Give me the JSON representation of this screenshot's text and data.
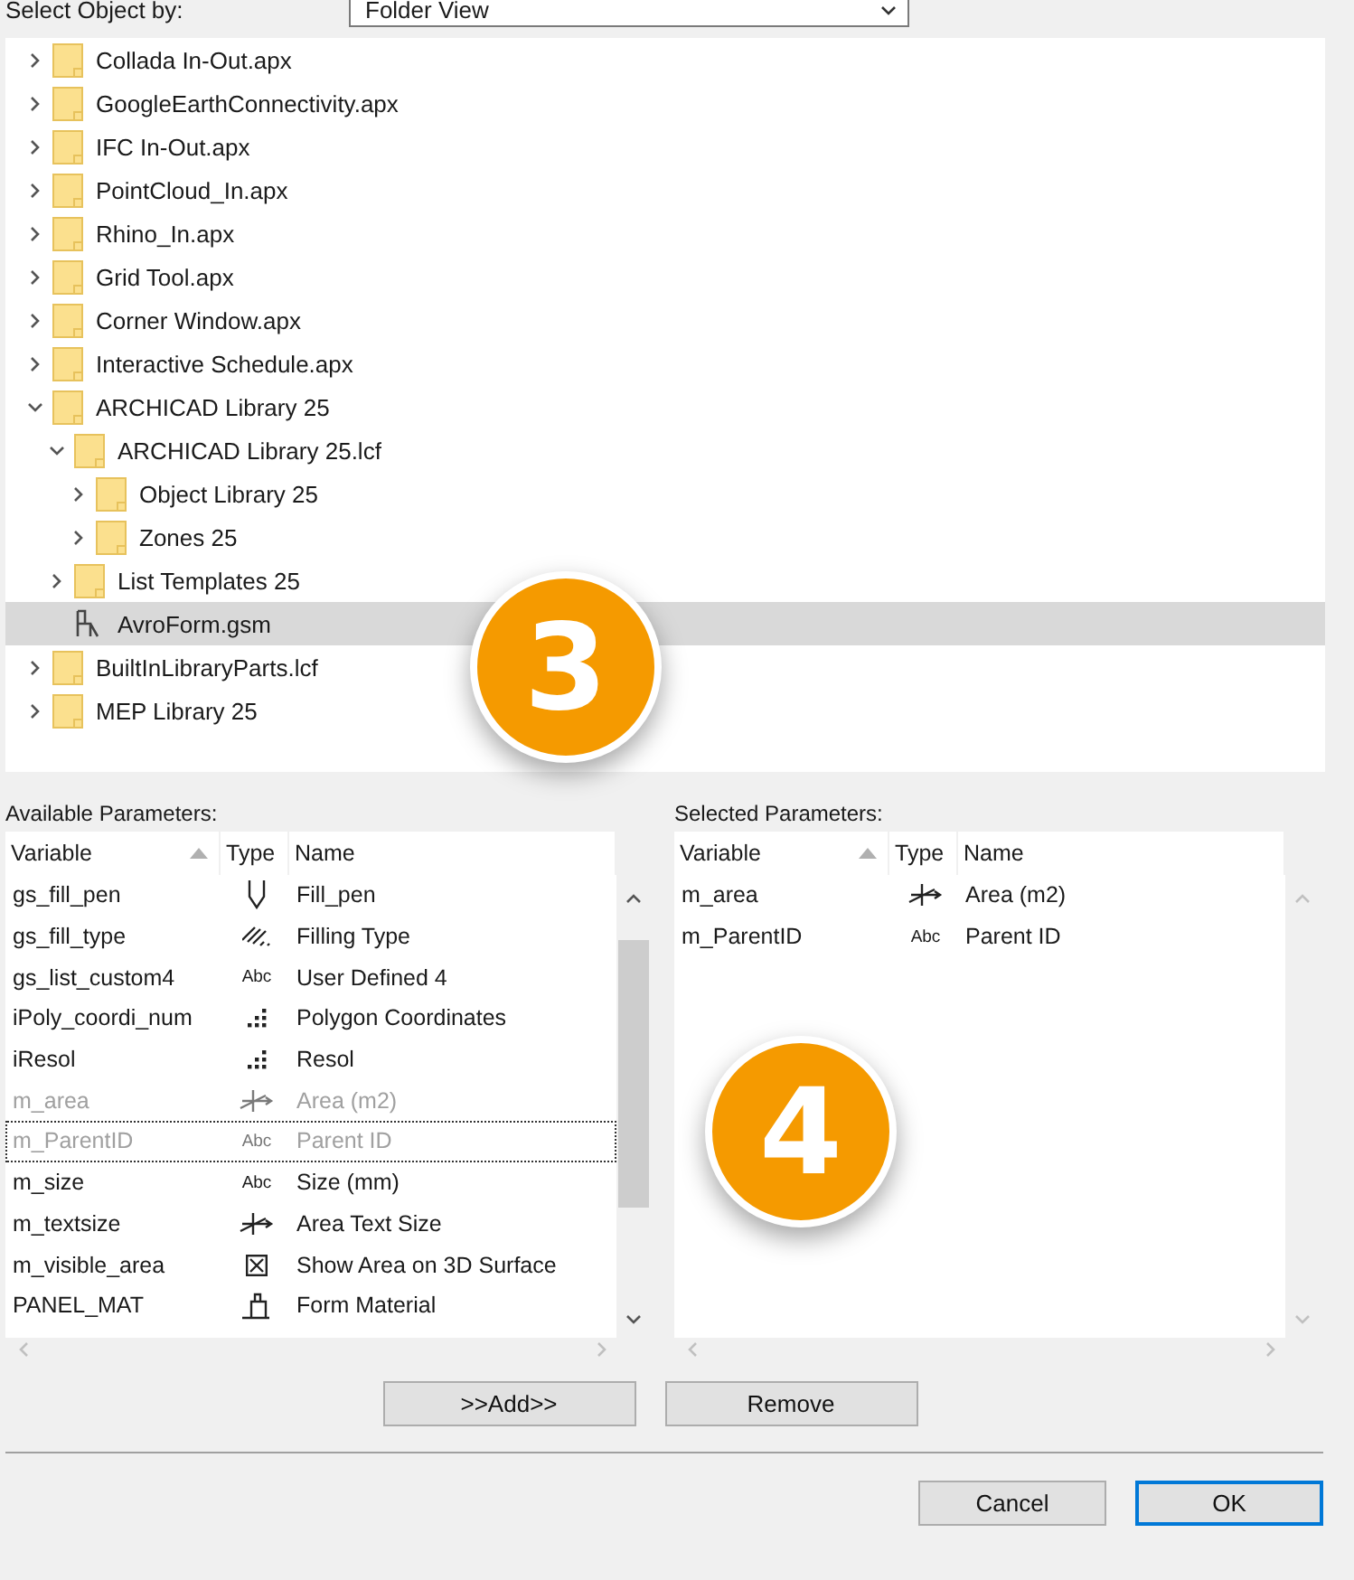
{
  "select_by": {
    "label": "Select Object by:",
    "value": "Folder View"
  },
  "tree": [
    {
      "label": "Collada In-Out.apx",
      "kind": "folder",
      "expanded": false,
      "selected": false
    },
    {
      "label": "GoogleEarthConnectivity.apx",
      "kind": "folder",
      "expanded": false,
      "selected": false
    },
    {
      "label": "IFC In-Out.apx",
      "kind": "folder",
      "expanded": false,
      "selected": false
    },
    {
      "label": "PointCloud_In.apx",
      "kind": "folder",
      "expanded": false,
      "selected": false
    },
    {
      "label": "Rhino_In.apx",
      "kind": "folder",
      "expanded": false,
      "selected": false
    },
    {
      "label": "Grid Tool.apx",
      "kind": "folder",
      "expanded": false,
      "selected": false
    },
    {
      "label": "Corner Window.apx",
      "kind": "folder",
      "expanded": false,
      "selected": false
    },
    {
      "label": "Interactive Schedule.apx",
      "kind": "folder",
      "expanded": false,
      "selected": false
    },
    {
      "label": "ARCHICAD Library 25",
      "kind": "folder",
      "expanded": true,
      "selected": false,
      "children": [
        {
          "label": "ARCHICAD Library 25.lcf",
          "kind": "folder",
          "expanded": true,
          "selected": false,
          "children": [
            {
              "label": "Object Library 25",
              "kind": "folder",
              "expanded": false,
              "selected": false
            },
            {
              "label": "Zones 25",
              "kind": "folder",
              "expanded": false,
              "selected": false
            }
          ]
        },
        {
          "label": "List Templates 25",
          "kind": "folder",
          "expanded": false,
          "selected": false
        },
        {
          "label": "AvroForm.gsm",
          "kind": "object",
          "selected": true
        }
      ]
    },
    {
      "label": "BuiltInLibraryParts.lcf",
      "kind": "folder",
      "expanded": false,
      "selected": false
    },
    {
      "label": "MEP Library 25",
      "kind": "folder",
      "expanded": false,
      "selected": false
    }
  ],
  "available": {
    "title": "Available Parameters:",
    "columns": [
      "Variable",
      "Type",
      "Name"
    ],
    "rows": [
      {
        "variable": "gs_fill_pen",
        "type": {
          "kind": "pen"
        },
        "name": "Fill_pen",
        "dimmed": false,
        "focused": false
      },
      {
        "variable": "gs_fill_type",
        "type": {
          "kind": "hatch"
        },
        "name": "Filling Type",
        "dimmed": false,
        "focused": false
      },
      {
        "variable": "gs_list_custom4",
        "type": {
          "kind": "text",
          "label": "Abc"
        },
        "name": "User Defined 4",
        "dimmed": false,
        "focused": false
      },
      {
        "variable": "iPoly_coordi_num",
        "type": {
          "kind": "integer"
        },
        "name": "Polygon Coordinates",
        "dimmed": false,
        "focused": false
      },
      {
        "variable": "iResol",
        "type": {
          "kind": "integer"
        },
        "name": "Resol",
        "dimmed": false,
        "focused": false
      },
      {
        "variable": "m_area",
        "type": {
          "kind": "area"
        },
        "name": "Area (m2)",
        "dimmed": true,
        "focused": false
      },
      {
        "variable": "m_ParentID",
        "type": {
          "kind": "text",
          "label": "Abc"
        },
        "name": "Parent ID",
        "dimmed": true,
        "focused": true
      },
      {
        "variable": "m_size",
        "type": {
          "kind": "text",
          "label": "Abc"
        },
        "name": "Size (mm)",
        "dimmed": false,
        "focused": false
      },
      {
        "variable": "m_textsize",
        "type": {
          "kind": "area"
        },
        "name": "Area Text Size",
        "dimmed": false,
        "focused": false
      },
      {
        "variable": "m_visible_area",
        "type": {
          "kind": "boolean"
        },
        "name": "Show Area on 3D Surface",
        "dimmed": false,
        "focused": false
      },
      {
        "variable": "PANEL_MAT",
        "type": {
          "kind": "material"
        },
        "name": "Form Material",
        "dimmed": false,
        "focused": false
      }
    ]
  },
  "selected": {
    "title": "Selected Parameters:",
    "columns": [
      "Variable",
      "Type",
      "Name"
    ],
    "rows": [
      {
        "variable": "m_area",
        "type": {
          "kind": "area"
        },
        "name": "Area (m2)",
        "dimmed": false,
        "focused": false
      },
      {
        "variable": "m_ParentID",
        "type": {
          "kind": "text",
          "label": "Abc"
        },
        "name": "Parent ID",
        "dimmed": false,
        "focused": false
      }
    ]
  },
  "add_button": ">>Add>>",
  "remove_button": "Remove",
  "buttons": [
    {
      "label": "Cancel",
      "default": false
    },
    {
      "label": "OK",
      "default": true
    }
  ],
  "callouts": [
    {
      "label": "3"
    },
    {
      "label": "4"
    }
  ]
}
